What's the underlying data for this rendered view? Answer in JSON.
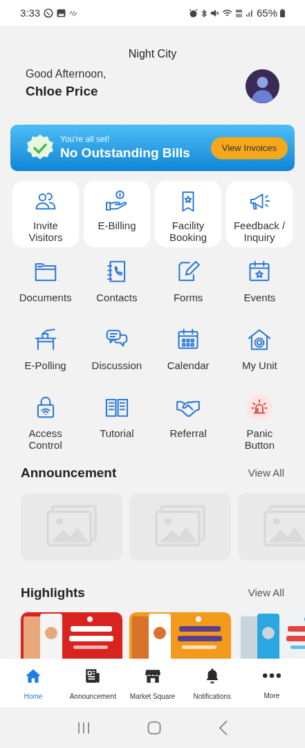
{
  "status_bar": {
    "time": "3:33",
    "battery": "65%"
  },
  "header": {
    "location": "Night City",
    "greeting": "Good Afternoon,",
    "user_name": "Chloe Price"
  },
  "bill_banner": {
    "subtitle": "You're all set!",
    "title": "No Outstanding Bills",
    "button": "View Invoices"
  },
  "quick_actions": [
    {
      "label": "Invite\nVisitors"
    },
    {
      "label": "E-Billing"
    },
    {
      "label": "Facility\nBooking"
    },
    {
      "label": "Feedback /\nInquiry"
    }
  ],
  "services": [
    {
      "label": "Documents",
      "kind": "normal"
    },
    {
      "label": "Contacts",
      "kind": "normal"
    },
    {
      "label": "Forms",
      "kind": "normal"
    },
    {
      "label": "Events",
      "kind": "normal"
    },
    {
      "label": "E-Polling",
      "kind": "normal"
    },
    {
      "label": "Discussion",
      "kind": "normal"
    },
    {
      "label": "Calendar",
      "kind": "normal"
    },
    {
      "label": "My Unit",
      "kind": "normal"
    },
    {
      "label": "Access\nControl",
      "kind": "normal"
    },
    {
      "label": "Tutorial",
      "kind": "normal"
    },
    {
      "label": "Referral",
      "kind": "normal"
    },
    {
      "label": "Panic\nButton",
      "kind": "alert"
    }
  ],
  "announcement": {
    "title": "Announcement",
    "view_all": "View All",
    "items": [
      {
        "kind": "placeholder"
      },
      {
        "kind": "placeholder"
      },
      {
        "kind": "placeholder"
      }
    ]
  },
  "highlights": {
    "title": "Highlights",
    "view_all": "View All"
  },
  "bottom_nav": [
    {
      "label": "Home",
      "selected": true
    },
    {
      "label": "Announcement",
      "selected": false
    },
    {
      "label": "Market Square",
      "selected": false
    },
    {
      "label": "Notifications",
      "selected": false
    },
    {
      "label": "More",
      "selected": false
    }
  ]
}
